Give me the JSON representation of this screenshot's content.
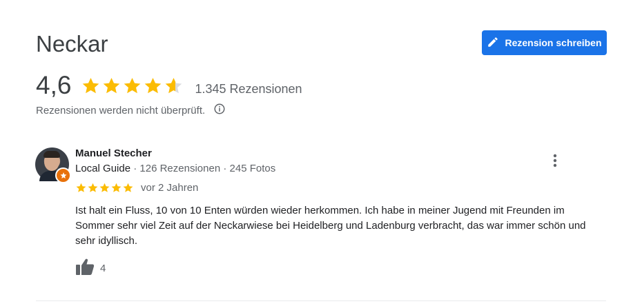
{
  "place": {
    "title": "Neckar",
    "rating_value": "4,6",
    "stars_fill": 4.6,
    "review_count_text": "1.345 Rezensionen",
    "not_checked_text": "Rezensionen werden nicht überprüft."
  },
  "actions": {
    "write_review_label": "Rezension schreiben"
  },
  "colors": {
    "accent": "#1a73e8",
    "star": "#fbbc04",
    "star_empty": "#dadce0",
    "guide_badge": "#e8710a"
  },
  "review": {
    "author": "Manuel Stecher",
    "guide_label": "Local Guide",
    "separator": " · ",
    "reviews_text": "126 Rezensionen",
    "photos_text": "245 Fotos",
    "stars": 5,
    "date": "vor 2 Jahren",
    "text": "Ist halt ein Fluss, 10 von 10 Enten würden wieder herkommen. Ich habe in meiner Jugend mit Freunden im Sommer sehr viel Zeit auf der Neckarwiese bei Heidelberg und Ladenburg verbracht,  das war immer schön und sehr idyllisch.",
    "likes": "4"
  },
  "icons": {
    "pencil": "pencil-icon",
    "info": "info-icon",
    "more": "more-vert-icon",
    "thumb": "thumb-up-icon",
    "badge": "local-guide-badge-icon"
  }
}
